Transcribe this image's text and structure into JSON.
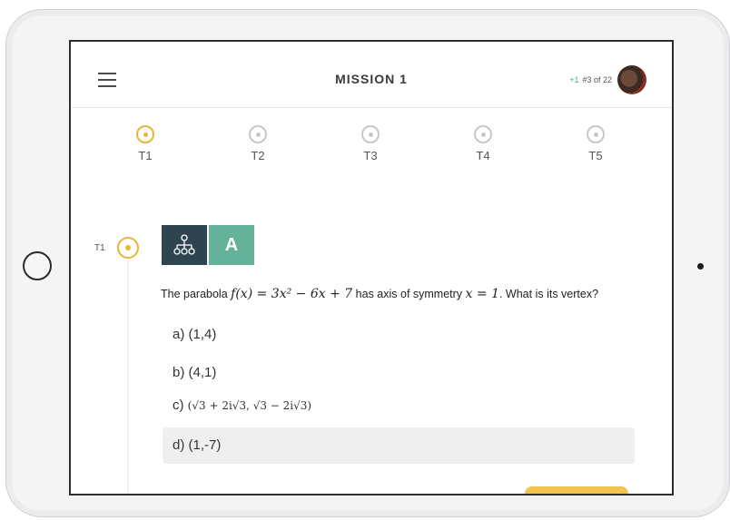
{
  "header": {
    "title": "MISSION 1",
    "rank_delta": "+1",
    "rank_text": "#3 of 22"
  },
  "steps": [
    {
      "label": "T1",
      "active": true
    },
    {
      "label": "T2",
      "active": false
    },
    {
      "label": "T3",
      "active": false
    },
    {
      "label": "T4",
      "active": false
    },
    {
      "label": "T5",
      "active": false
    }
  ],
  "timeline": {
    "label": "T1"
  },
  "tiles": {
    "level_letter": "A",
    "icon": "hierarchy-icon"
  },
  "question": {
    "prefix": "The parabola",
    "function": "f(x) = 3x² − 6x + 7",
    "middle": "has axis of symmetry",
    "axis": "x = 1",
    "suffix": ". What is its vertex?"
  },
  "options": [
    {
      "label": "a) (1,4)"
    },
    {
      "label": "b) (4,1)"
    },
    {
      "prefix": "c)",
      "label": "(√3 + 2i√3, √3 − 2i√3)"
    },
    {
      "label": "d) (1,-7)"
    }
  ],
  "colors": {
    "accent": "#e8b53a",
    "tile_dark": "#2f4451",
    "tile_green": "#64b29a",
    "rank_delta": "#3cb878",
    "button_yellow": "#f0c44f"
  }
}
